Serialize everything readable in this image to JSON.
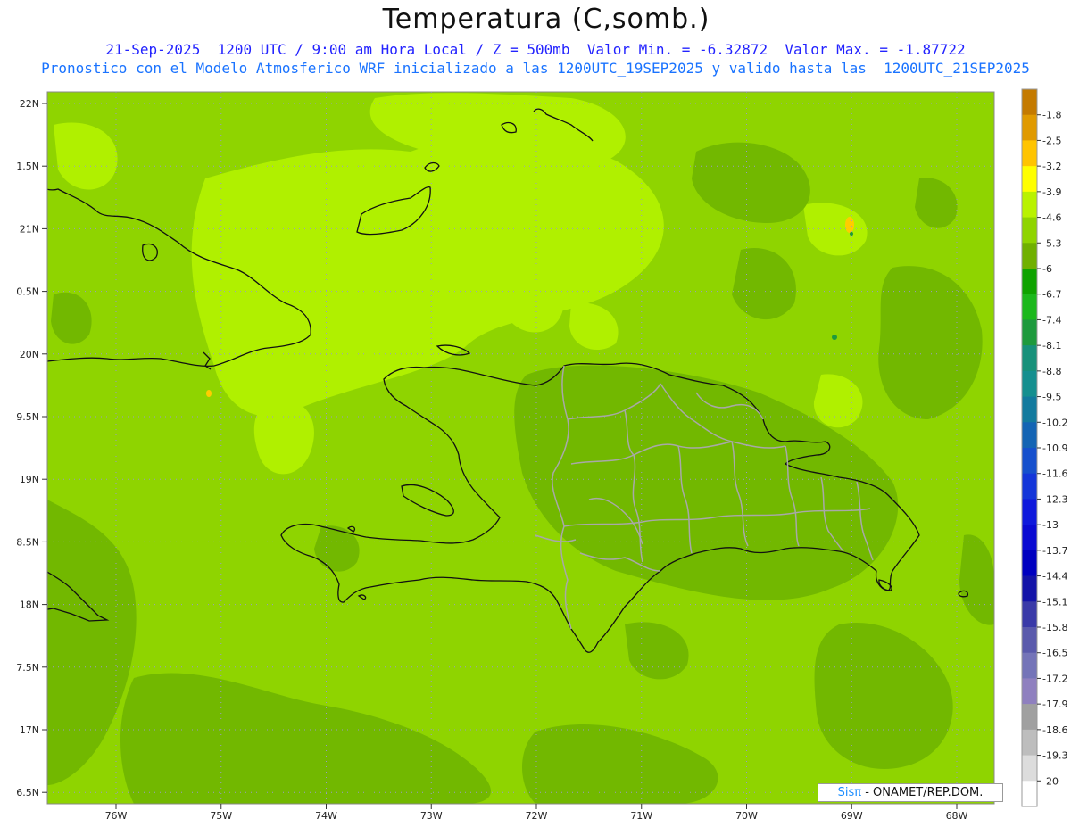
{
  "header": {
    "title": "Temperatura (C,somb.)",
    "line1": "21-Sep-2025  1200 UTC / 9:00 am Hora Local / Z = 500mb  Valor Min. = -6.32872  Valor Max. = -1.87722",
    "line2": "Pronostico con el Modelo Atmosferico WRF inicializado a las 1200UTC_19SEP2025 y valido hasta las  1200UTC_21SEP2025"
  },
  "axes": {
    "y_labels": [
      "22N",
      "1.5N",
      "21N",
      "0.5N",
      "20N",
      "9.5N",
      "19N",
      "8.5N",
      "18N",
      "7.5N",
      "17N",
      "6.5N"
    ],
    "x_labels": [
      "76W",
      "75W",
      "74W",
      "73W",
      "72W",
      "71W",
      "70W",
      "69W",
      "68W"
    ]
  },
  "legend": {
    "labels": [
      "-1.8",
      "-2.5",
      "-3.2",
      "-3.9",
      "-4.6",
      "-5.3",
      "-6",
      "-6.7",
      "-7.4",
      "-8.1",
      "-8.8",
      "-9.5",
      "-10.2",
      "-10.9",
      "-11.6",
      "-12.3",
      "-13",
      "-13.7",
      "-14.4",
      "-15.1",
      "-15.8",
      "-16.5",
      "-17.2",
      "-17.9",
      "-18.6",
      "-19.3",
      "-20"
    ],
    "colors": [
      "#c47a00",
      "#e09a00",
      "#ffc400",
      "#ffff00",
      "#b9f200",
      "#8fd400",
      "#70b000",
      "#0fa300",
      "#1cb81c",
      "#1e9a3d",
      "#17917a",
      "#158f8f",
      "#137a9e",
      "#1464b4",
      "#1650cd",
      "#1436d9",
      "#0f19dc",
      "#0a0ad2",
      "#0000c0",
      "#1414a8",
      "#3a3aa8",
      "#5a5aac",
      "#7474b8",
      "#8f80bf",
      "#a0a0a0",
      "#bdbdbd",
      "#dcdcdc",
      "#ffffff"
    ]
  },
  "field_colors": {
    "base": "#8fd400",
    "warm": "#b0f000",
    "cool": "#72b800",
    "hot_spot": "#ffcc00",
    "coast": "#111111",
    "province_border": "#a8a8a8"
  },
  "credit": {
    "brand": "Sisπ",
    "text": " - ONAMET/REP.DOM."
  }
}
